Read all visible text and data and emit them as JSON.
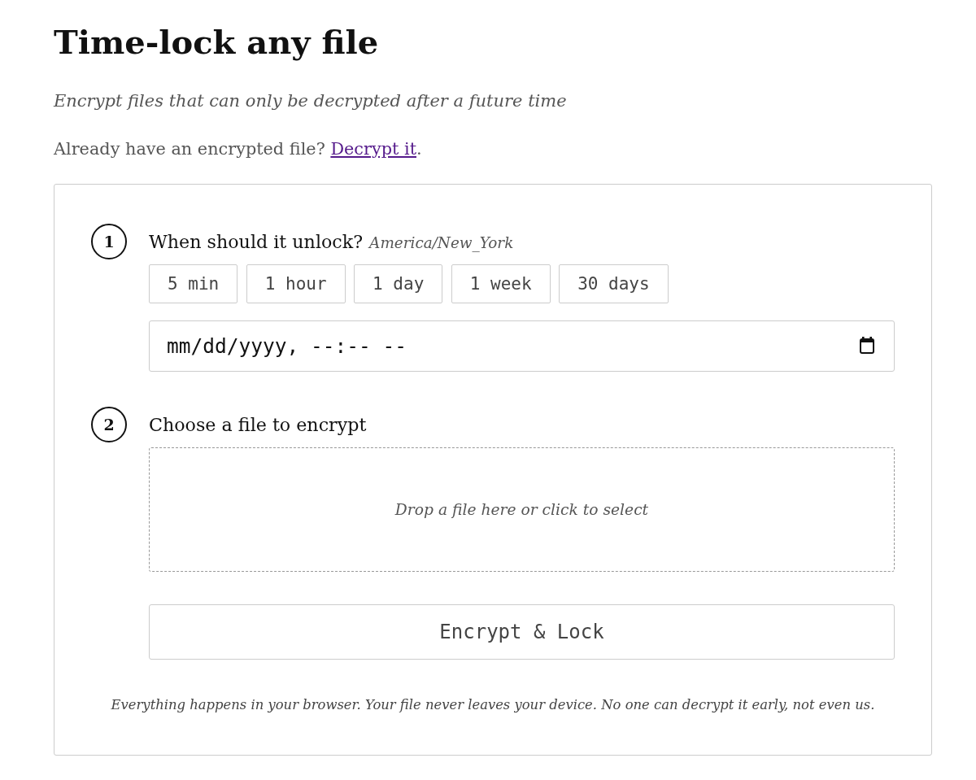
{
  "page": {
    "title": "Time-lock any file",
    "subtitle": "Encrypt files that can only be decrypted after a future time",
    "decrypt_prompt": {
      "text": "Already have an encrypted file?",
      "link": "Decrypt it",
      "after": "."
    }
  },
  "steps": [
    {
      "number": "1",
      "kind": "time",
      "label": "When should it unlock?",
      "timezone": "America/New_York",
      "presets": [
        "5 min",
        "1 hour",
        "1 day",
        "1 week",
        "30 days"
      ],
      "datetime_field": {
        "placeholder": "mm/dd/yyyy, --:-- --"
      }
    },
    {
      "number": "2",
      "kind": "file",
      "label": "Choose a file to encrypt",
      "dropzone": {
        "text": "Drop a file here or click to select"
      }
    }
  ],
  "submit_button": "Encrypt & Lock",
  "footer_note": "Everything happens in your browser. Your file never leaves your device. No one can decrypt it early, not even us."
}
